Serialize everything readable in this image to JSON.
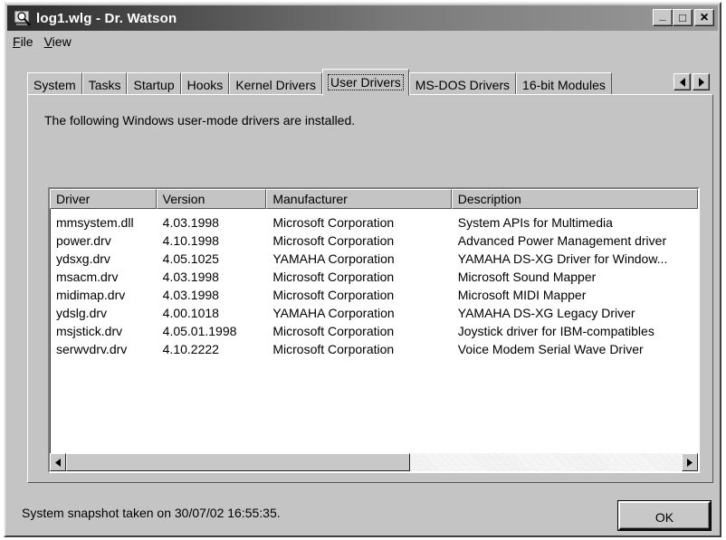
{
  "window": {
    "title": "log1.wlg - Dr. Watson",
    "minimize_glyph": "_",
    "maximize_glyph": "□",
    "close_glyph": "×"
  },
  "menu": {
    "file_label": "File",
    "view_label": "View"
  },
  "tabs": [
    {
      "label": "System"
    },
    {
      "label": "Tasks"
    },
    {
      "label": "Startup"
    },
    {
      "label": "Hooks"
    },
    {
      "label": "Kernel Drivers"
    },
    {
      "label": "User Drivers"
    },
    {
      "label": "MS-DOS Drivers"
    },
    {
      "label": "16-bit Modules"
    }
  ],
  "active_tab": "User Drivers",
  "panel": {
    "intro": "The following Windows user-mode drivers are installed."
  },
  "table": {
    "columns": [
      "Driver",
      "Version",
      "Manufacturer",
      "Description"
    ],
    "rows": [
      [
        "mmsystem.dll",
        "4.03.1998",
        "Microsoft Corporation",
        "System APIs for Multimedia"
      ],
      [
        "power.drv",
        "4.10.1998",
        "Microsoft Corporation",
        "Advanced Power Management driver"
      ],
      [
        "ydsxg.drv",
        "4.05.1025",
        "YAMAHA Corporation",
        "YAMAHA DS-XG Driver for Window..."
      ],
      [
        "msacm.drv",
        "4.03.1998",
        "Microsoft Corporation",
        "Microsoft Sound Mapper"
      ],
      [
        "midimap.drv",
        "4.03.1998",
        "Microsoft Corporation",
        "Microsoft MIDI Mapper"
      ],
      [
        "ydslg.drv",
        "4.00.1018",
        "YAMAHA Corporation",
        "YAMAHA DS-XG Legacy Driver"
      ],
      [
        "msjstick.drv",
        "4.05.01.1998",
        "Microsoft Corporation",
        "Joystick driver for IBM-compatibles"
      ],
      [
        "serwvdrv.drv",
        "4.10.2222",
        "Microsoft Corporation",
        "Voice Modem Serial Wave Driver"
      ]
    ]
  },
  "status": {
    "text": "System snapshot taken on 30/07/02 16:55:35."
  },
  "buttons": {
    "ok_label": "OK"
  },
  "icons": {
    "app": "dr-watson-icon",
    "tab_left": "arrow-left-icon",
    "tab_right": "arrow-right-icon",
    "scroll_left": "arrow-left-icon",
    "scroll_right": "arrow-right-icon"
  }
}
